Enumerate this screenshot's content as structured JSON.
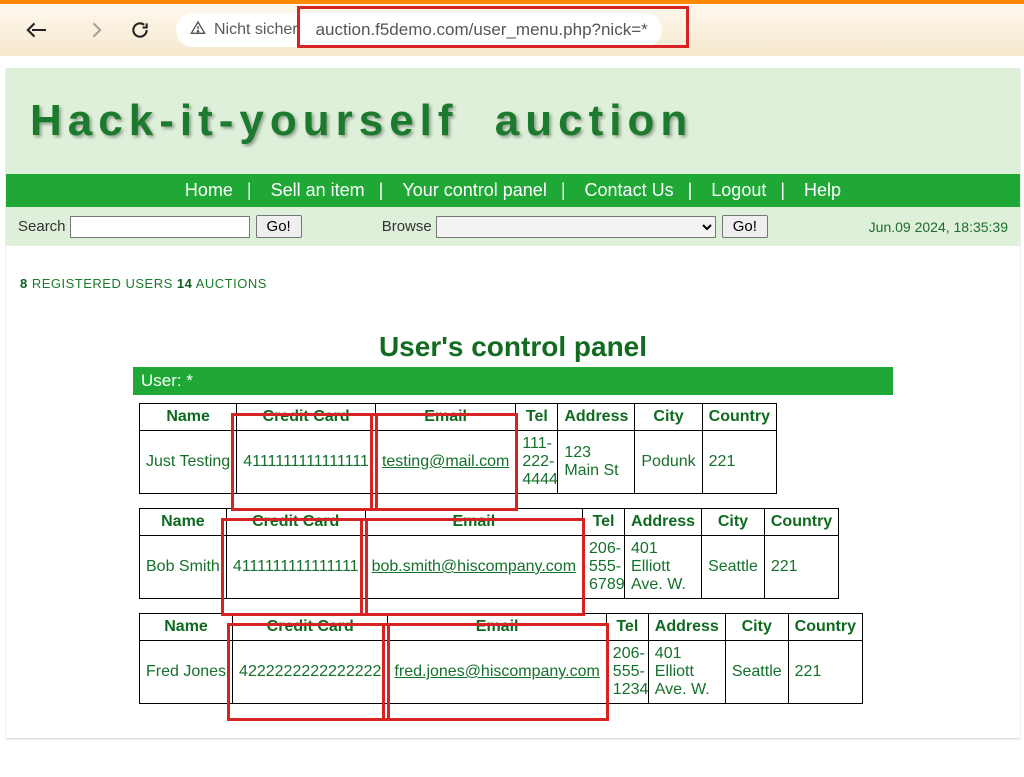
{
  "browser": {
    "security_label": "Nicht sicher",
    "url": "auction.f5demo.com/user_menu.php?nick=*"
  },
  "banner": {
    "title": "Hack-it-yourself auction"
  },
  "nav": {
    "home": "Home",
    "sell": "Sell an item",
    "panel": "Your control panel",
    "contact": "Contact Us",
    "logout": "Logout",
    "help": "Help"
  },
  "util": {
    "search_label": "Search",
    "search_go": "Go!",
    "browse_label": "Browse",
    "browse_go": "Go!",
    "timestamp": "Jun.09 2024, 18:35:39"
  },
  "stats": {
    "users_n": "8",
    "users_lbl": " REGISTERED USERS   ",
    "auc_n": "14",
    "auc_lbl": " AUCTIONS"
  },
  "panel": {
    "title": "User's control panel",
    "user_line": "User: *",
    "headers": {
      "name": "Name",
      "cc": "Credit Card",
      "email": "Email",
      "tel": "Tel",
      "addr": "Address",
      "city": "City",
      "country": "Country"
    },
    "rows": [
      {
        "name": "Just Testing",
        "cc": "4111111111111111",
        "email": "testing@mail.com",
        "tel": "111-222-4444",
        "addr": "123 Main St",
        "city": "Podunk",
        "country": "221"
      },
      {
        "name": "Bob Smith",
        "cc": "4111111111111111",
        "email": "bob.smith@hiscompany.com",
        "tel": "206-555-6789",
        "addr": "401 Elliott Ave. W.",
        "city": "Seattle",
        "country": "221"
      },
      {
        "name": "Fred Jones",
        "cc": "4222222222222222",
        "email": "fred.jones@hiscompany.com",
        "tel": "206-555-1234",
        "addr": "401 Elliott Ave. W.",
        "city": "Seattle",
        "country": "221"
      }
    ]
  }
}
